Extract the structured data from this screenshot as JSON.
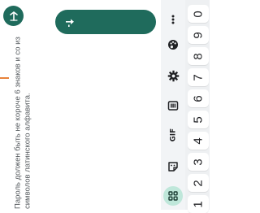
{
  "screen": {
    "hint_text": "Пароль должен быть не короче 6 знаков и со из символов латинского алфавита.",
    "accent_color": "#1f6b5c",
    "divider_color": "#e8833a"
  },
  "keyboard": {
    "toolbar": {
      "icons": [
        "more-vertical-icon",
        "palette-icon",
        "gear-icon",
        "clipboard-icon",
        "gif",
        "sticker-icon",
        "apps-grid-icon"
      ],
      "gif_label": "GIF"
    },
    "number_keys": [
      "0",
      "9",
      "8",
      "7",
      "6",
      "5",
      "4",
      "3",
      "2",
      "1"
    ]
  }
}
